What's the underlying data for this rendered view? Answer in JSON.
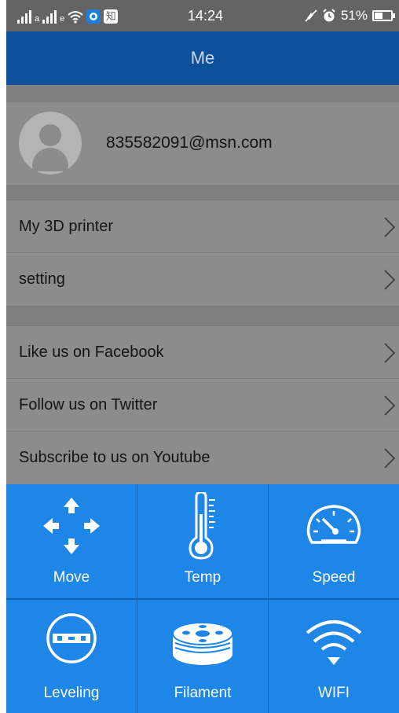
{
  "status_bar": {
    "time": "14:24",
    "battery": "51%",
    "battery_level": 0.51,
    "icons": [
      "signal-icon",
      "wifi-icon",
      "app-icon",
      "zhihu-icon",
      "mute-icon",
      "alarm-icon",
      "battery-icon"
    ],
    "zhihu_glyph": "知"
  },
  "header": {
    "title": "Me"
  },
  "profile": {
    "email": "835582091@msn.com"
  },
  "menu_groups": [
    {
      "items": [
        {
          "label": "My 3D printer"
        },
        {
          "label": "setting"
        }
      ]
    },
    {
      "items": [
        {
          "label": "Like us on Facebook"
        },
        {
          "label": "Follow us on Twitter"
        },
        {
          "label": "Subscribe to us on Youtube"
        }
      ]
    }
  ],
  "tools": [
    {
      "label": "Move",
      "icon": "move-arrows-icon"
    },
    {
      "label": "Temp",
      "icon": "thermometer-icon"
    },
    {
      "label": "Speed",
      "icon": "speedometer-icon"
    },
    {
      "label": "Leveling",
      "icon": "level-icon"
    },
    {
      "label": "Filament",
      "icon": "filament-spool-icon"
    },
    {
      "label": "WIFI",
      "icon": "wifi-icon"
    }
  ],
  "colors": {
    "title_bar": "#0d519b",
    "tool_grid": "#1e86e6",
    "overlay": "#8c8c8c"
  }
}
